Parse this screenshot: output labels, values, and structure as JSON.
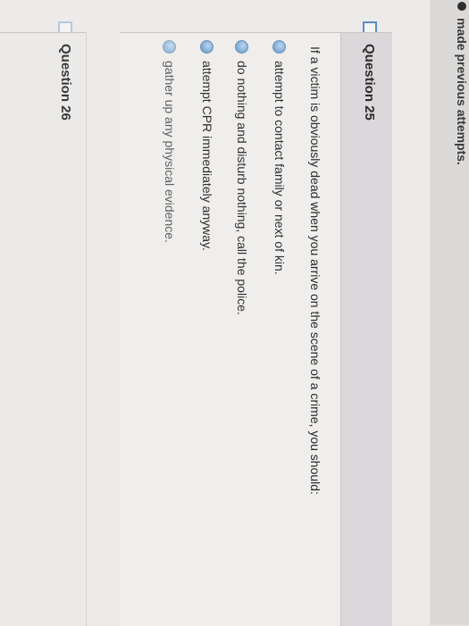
{
  "top_bar": {
    "text": "made previous attempts."
  },
  "question_25": {
    "title": "Question 25",
    "prompt": "If a victim is obviously dead when you arrive on the scene of a crime, you should:",
    "answers": [
      "attempt to contact family or next of kin.",
      "do nothing and disturb nothing, call the police.",
      "attempt CPR immediately anyway.",
      "gather up any physical evidence."
    ]
  },
  "question_26": {
    "title": "Question 26"
  }
}
